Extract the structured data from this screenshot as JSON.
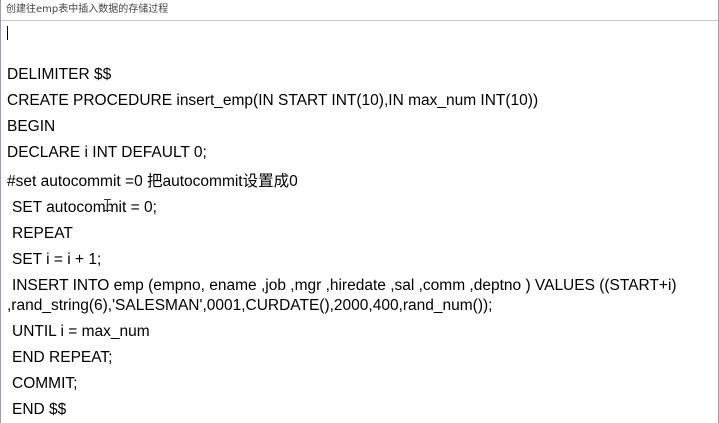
{
  "window": {
    "title": "创建往emp表中插入数据的存储过程"
  },
  "editor": {
    "lines": [
      "DELIMITER $$",
      "CREATE PROCEDURE insert_emp(IN START INT(10),IN max_num INT(10))",
      "BEGIN",
      "DECLARE i INT DEFAULT 0;",
      "#set autocommit =0 把autocommit设置成0",
      "SET autocommit = 0;",
      "REPEAT",
      "SET i = i + 1;",
      "INSERT INTO emp (empno, ename ,job ,mgr ,hiredate ,sal ,comm ,deptno ) VALUES ((START+i)",
      ",rand_string(6),'SALESMAN',0001,CURDATE(),2000,400,rand_num());",
      "UNTIL i = max_num",
      "END REPEAT;",
      "COMMIT;",
      "END $$"
    ]
  }
}
